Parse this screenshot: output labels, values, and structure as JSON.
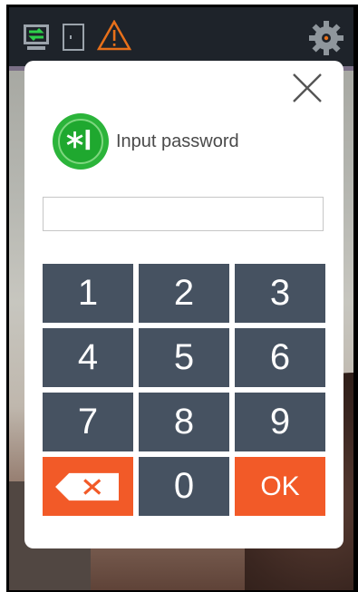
{
  "dialog": {
    "title": "Input password",
    "password_value": "",
    "keys": {
      "k1": "1",
      "k2": "2",
      "k3": "3",
      "k4": "4",
      "k5": "5",
      "k6": "6",
      "k7": "7",
      "k8": "8",
      "k9": "9",
      "k0": "0",
      "ok": "OK"
    }
  },
  "colors": {
    "keypad_bg": "#465261",
    "action_orange": "#f25a28",
    "badge_green": "#2bb43a",
    "status_bar": "#1e232a",
    "warning_orange": "#e8701a"
  },
  "icons": {
    "network": "network-icon",
    "door": "door-icon",
    "warning": "warning-icon",
    "settings": "gear-icon",
    "close": "close-icon",
    "password_badge": "asterisk-icon",
    "backspace": "backspace-icon"
  }
}
